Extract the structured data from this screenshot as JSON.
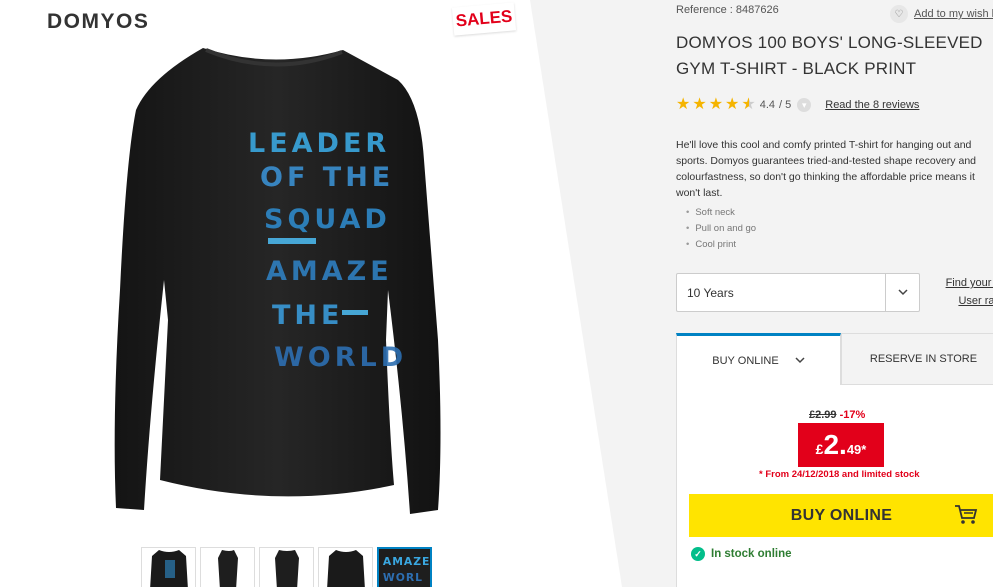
{
  "brand": "DOMYOS",
  "sales_tag": "SALES",
  "product": {
    "reference": "Reference : 8487626",
    "wishlist": "Add to my wish l",
    "title": "DOMYOS 100 BOYS' LONG-SLEEVED GYM T-SHIRT - BLACK PRINT",
    "rating_value": "4.4",
    "rating_max": "/ 5",
    "rating_stars": 4.4,
    "reviews_link": "Read the 8 reviews",
    "description": "He'll love this cool and comfy printed T-shirt for hanging out and sports. Domyos guarantees tried-and-tested shape recovery and colourfastness, so don't go thinking the affordable price means it won't last.",
    "features": [
      "Soft neck",
      "Pull on and go",
      "Cool print"
    ],
    "shirt_print": [
      "LEADER",
      "OF THE",
      "SQUAD",
      "AMAZE",
      "THE",
      "WORLD"
    ]
  },
  "size": {
    "selected": "10 Years",
    "find_size_link": "Find your s",
    "user_ratings_link": "User rati"
  },
  "tabs": {
    "buy_online": "BUY ONLINE",
    "reserve": "RESERVE IN STORE"
  },
  "price": {
    "old": "£2.99",
    "discount": "-17%",
    "currency": "£",
    "integer": "2.",
    "decimals": "49*",
    "note": "* From 24/12/2018 and limited stock"
  },
  "buy_button": "BUY ONLINE",
  "stock": "In stock online",
  "colors": {
    "accent_blue": "#0082c3",
    "sale_red": "#e2001a",
    "buy_yellow": "#ffe400",
    "stock_green": "#02be8a",
    "star_gold": "#f5b400"
  }
}
